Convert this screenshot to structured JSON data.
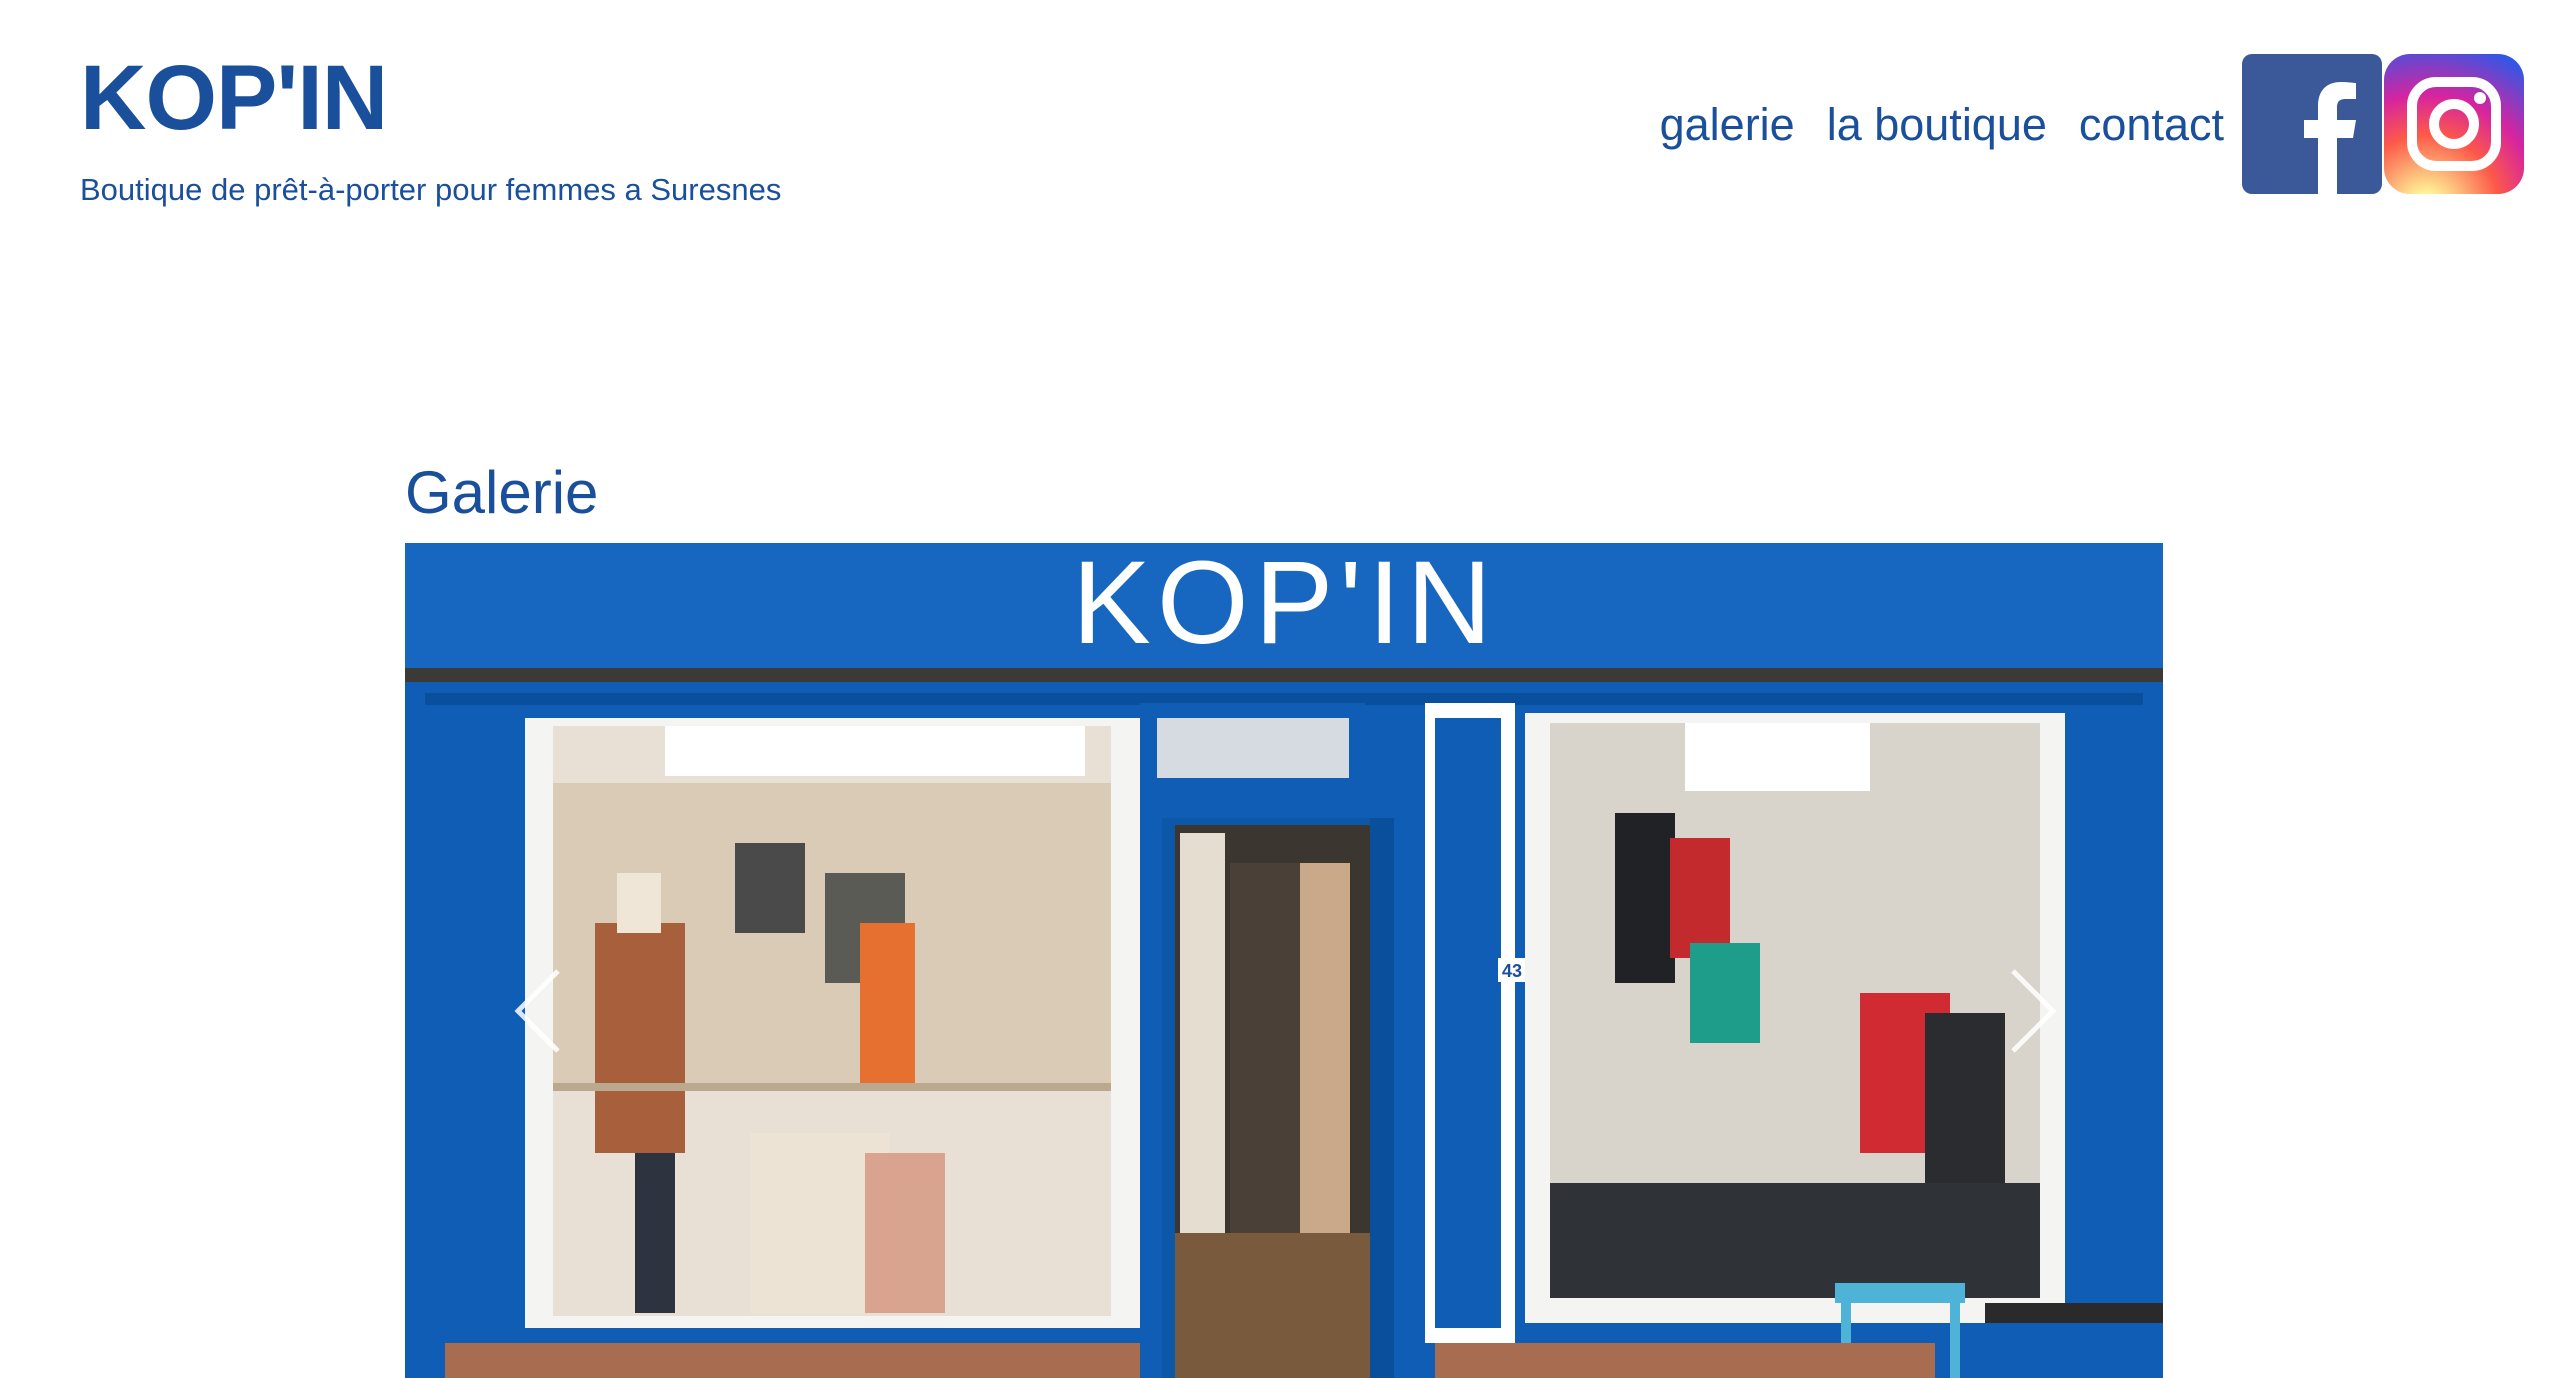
{
  "header": {
    "brand_title": "KOP'IN",
    "brand_subtitle": "Boutique de prêt-à-porter pour femmes a Suresnes"
  },
  "nav": {
    "items": [
      {
        "label": "galerie"
      },
      {
        "label": "la boutique"
      },
      {
        "label": "contact"
      }
    ],
    "social": [
      {
        "name": "facebook-icon"
      },
      {
        "name": "instagram-icon"
      }
    ]
  },
  "main": {
    "title": "Galerie"
  },
  "gallery": {
    "storefront_sign": "KOP'IN",
    "house_number": "43",
    "controls": [
      "previous",
      "next"
    ]
  },
  "colors": {
    "brand_blue": "#1a4f9c",
    "storefront_blue": "#0f5db4",
    "facebook_blue": "#3b5998"
  }
}
